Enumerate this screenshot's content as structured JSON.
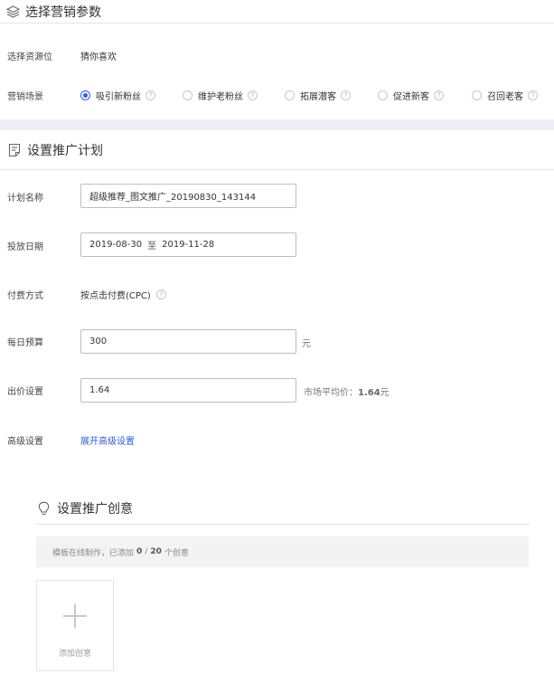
{
  "section1": {
    "title": "选择营销参数",
    "icon": "layers-icon",
    "resource_label": "选择资源位",
    "resource_value": "猜你喜欢",
    "scene_label": "营销场景",
    "scenes": [
      {
        "label": "吸引新粉丝",
        "checked": true
      },
      {
        "label": "维护老粉丝",
        "checked": false
      },
      {
        "label": "拓展潜客",
        "checked": false
      },
      {
        "label": "促进新客",
        "checked": false
      },
      {
        "label": "召回老客",
        "checked": false
      }
    ],
    "help_glyph": "?"
  },
  "section2": {
    "title": "设置推广计划",
    "icon": "document-icon",
    "plan_name_label": "计划名称",
    "plan_name_value": "超级推荐_图文推广_20190830_143144",
    "date_label": "投放日期",
    "date_start": "2019-08-30",
    "date_sep": "至",
    "date_end": "2019-11-28",
    "pay_label": "付费方式",
    "pay_value": "按点击付费(CPC)",
    "budget_label": "每日预算",
    "budget_value": "300",
    "budget_unit": "元",
    "bid_label": "出价设置",
    "bid_value": "1.64",
    "market_avg_prefix": "市场平均价：",
    "market_avg_value": "1.64",
    "market_avg_unit": "元",
    "advanced_label": "高级设置",
    "advanced_link": "展开高级设置"
  },
  "section3": {
    "title": "设置推广创意",
    "icon": "lightbulb-icon",
    "info_prefix": "模板在线制作，已添加",
    "added_count": "0",
    "slash": "/",
    "max_count": "20",
    "info_suffix": "个创意",
    "add_label": "添加创意"
  },
  "colors": {
    "accent": "#2f5bea",
    "link": "#2e5bd8",
    "band": "#eceef5"
  }
}
